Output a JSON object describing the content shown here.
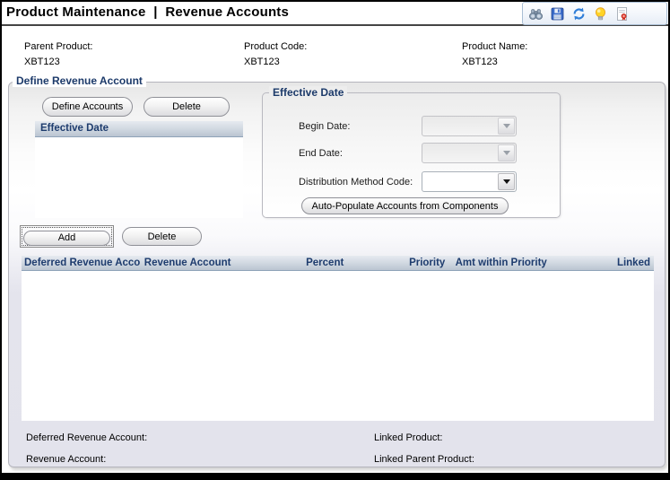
{
  "title": "Product Maintenance  |  Revenue Accounts",
  "toolbar": {
    "icons": [
      "find-binoculars",
      "save",
      "refresh",
      "tip-bulb",
      "pdf-report"
    ]
  },
  "product_info": {
    "parent_product_label": "Parent Product:",
    "parent_product_value": "XBT123",
    "product_code_label": "Product Code:",
    "product_code_value": "XBT123",
    "product_name_label": "Product Name:",
    "product_name_value": "XBT123"
  },
  "define_revenue_account": {
    "legend": "Define Revenue Account",
    "define_accounts_button": "Define Accounts",
    "delete_button": "Delete",
    "effective_date_list": {
      "header": "Effective Date",
      "rows": []
    },
    "effective_date_group": {
      "legend": "Effective Date",
      "begin_date_label": "Begin Date:",
      "begin_date_value": "",
      "begin_date_disabled": true,
      "end_date_label": "End Date:",
      "end_date_value": "",
      "end_date_disabled": true,
      "distribution_method_label": "Distribution Method Code:",
      "distribution_method_value": "",
      "distribution_method_disabled": false,
      "auto_populate_button": "Auto-Populate Accounts from Components"
    },
    "accounts_section": {
      "add_button": "Add",
      "delete_button": "Delete",
      "table_headers": [
        "Deferred Revenue Acco",
        "Revenue Account",
        "Percent",
        "Priority",
        "Amt within Priority",
        "Linked"
      ],
      "rows": [],
      "footer": {
        "deferred_revenue_account_label": "Deferred Revenue Account:",
        "revenue_account_label": "Revenue Account:",
        "linked_product_label": "Linked Product:",
        "linked_parent_product_label": "Linked Parent Product:"
      }
    }
  },
  "colors": {
    "header_text_navy": "#1e3c6e",
    "panel_lavender": "#e3e3ec",
    "grid_header_top": "#e6eaf0",
    "grid_header_bottom": "#bac4d1",
    "window_border": "#000000"
  }
}
